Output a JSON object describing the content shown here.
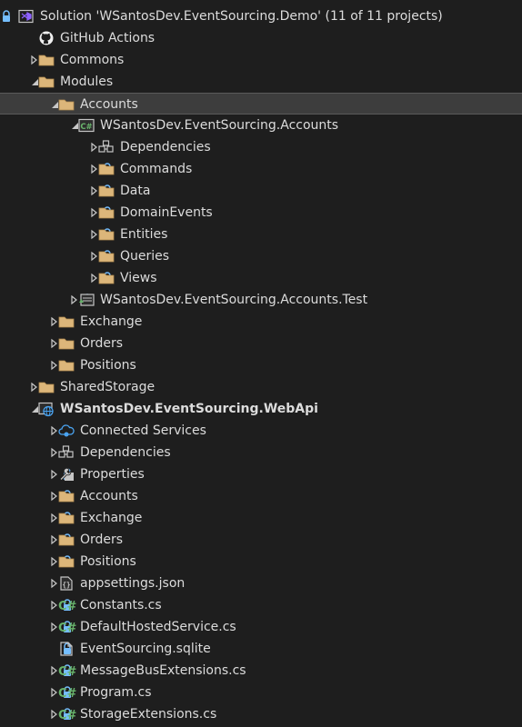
{
  "colors": {
    "background": "#1e1e1e",
    "text": "#dcdcdc",
    "selection": "#3d3d3d",
    "folder": "#dcb67a",
    "lock": "#75beff",
    "csharp": "#68b36b",
    "vs_purple": "#8e62ff"
  },
  "tree": [
    {
      "label": "Solution 'WSantosDev.EventSourcing.Demo' (11 of 11 projects)",
      "icon": "solution-icon",
      "expander": "none",
      "locked": true,
      "level": 0
    },
    {
      "label": "GitHub Actions",
      "icon": "github-icon",
      "expander": "none",
      "locked": false,
      "level": 1
    },
    {
      "label": "Commons",
      "icon": "folder-icon",
      "expander": "collapsed",
      "locked": false,
      "level": 1
    },
    {
      "label": "Modules",
      "icon": "folder-icon",
      "expander": "expanded",
      "locked": false,
      "level": 1
    },
    {
      "label": "Accounts",
      "icon": "folder-icon",
      "expander": "expanded",
      "locked": false,
      "level": 2,
      "selected": true
    },
    {
      "label": "WSantosDev.EventSourcing.Accounts",
      "icon": "csharp-project-icon",
      "expander": "expanded",
      "locked": true,
      "level": 3
    },
    {
      "label": "Dependencies",
      "icon": "dependencies-icon",
      "expander": "collapsed",
      "locked": false,
      "level": 4
    },
    {
      "label": "Commands",
      "icon": "folder-icon",
      "expander": "collapsed",
      "locked": true,
      "level": 4
    },
    {
      "label": "Data",
      "icon": "folder-icon",
      "expander": "collapsed",
      "locked": true,
      "level": 4
    },
    {
      "label": "DomainEvents",
      "icon": "folder-icon",
      "expander": "collapsed",
      "locked": true,
      "level": 4
    },
    {
      "label": "Entities",
      "icon": "folder-icon",
      "expander": "collapsed",
      "locked": true,
      "level": 4
    },
    {
      "label": "Queries",
      "icon": "folder-icon",
      "expander": "collapsed",
      "locked": true,
      "level": 4
    },
    {
      "label": "Views",
      "icon": "folder-icon",
      "expander": "collapsed",
      "locked": true,
      "level": 4
    },
    {
      "label": "WSantosDev.EventSourcing.Accounts.Test",
      "icon": "test-project-icon",
      "expander": "collapsed",
      "locked": true,
      "level": 3
    },
    {
      "label": "Exchange",
      "icon": "folder-icon",
      "expander": "collapsed",
      "locked": false,
      "level": 2
    },
    {
      "label": "Orders",
      "icon": "folder-icon",
      "expander": "collapsed",
      "locked": false,
      "level": 2
    },
    {
      "label": "Positions",
      "icon": "folder-icon",
      "expander": "collapsed",
      "locked": false,
      "level": 2
    },
    {
      "label": "SharedStorage",
      "icon": "folder-icon",
      "expander": "collapsed",
      "locked": false,
      "level": 1
    },
    {
      "label": "WSantosDev.EventSourcing.WebApi",
      "icon": "web-project-icon",
      "expander": "expanded",
      "locked": true,
      "level": 1,
      "bold": true
    },
    {
      "label": "Connected Services",
      "icon": "connected-services-icon",
      "expander": "collapsed",
      "locked": false,
      "level": 2
    },
    {
      "label": "Dependencies",
      "icon": "dependencies-icon",
      "expander": "collapsed",
      "locked": false,
      "level": 2
    },
    {
      "label": "Properties",
      "icon": "properties-icon",
      "expander": "collapsed",
      "locked": true,
      "level": 2
    },
    {
      "label": "Accounts",
      "icon": "folder-icon",
      "expander": "collapsed",
      "locked": true,
      "level": 2
    },
    {
      "label": "Exchange",
      "icon": "folder-icon",
      "expander": "collapsed",
      "locked": true,
      "level": 2
    },
    {
      "label": "Orders",
      "icon": "folder-icon",
      "expander": "collapsed",
      "locked": true,
      "level": 2
    },
    {
      "label": "Positions",
      "icon": "folder-icon",
      "expander": "collapsed",
      "locked": true,
      "level": 2
    },
    {
      "label": "appsettings.json",
      "icon": "json-file-icon",
      "expander": "collapsed",
      "locked": true,
      "level": 2
    },
    {
      "label": "Constants.cs",
      "icon": "csharp-file-icon",
      "expander": "collapsed",
      "locked": true,
      "level": 2
    },
    {
      "label": "DefaultHostedService.cs",
      "icon": "csharp-file-icon",
      "expander": "collapsed",
      "locked": true,
      "level": 2
    },
    {
      "label": "EventSourcing.sqlite",
      "icon": "file-icon",
      "expander": "none",
      "locked": true,
      "level": 2
    },
    {
      "label": "MessageBusExtensions.cs",
      "icon": "csharp-file-icon",
      "expander": "collapsed",
      "locked": true,
      "level": 2
    },
    {
      "label": "Program.cs",
      "icon": "csharp-file-icon",
      "expander": "collapsed",
      "locked": true,
      "level": 2
    },
    {
      "label": "StorageExtensions.cs",
      "icon": "csharp-file-icon",
      "expander": "collapsed",
      "locked": true,
      "level": 2
    }
  ]
}
